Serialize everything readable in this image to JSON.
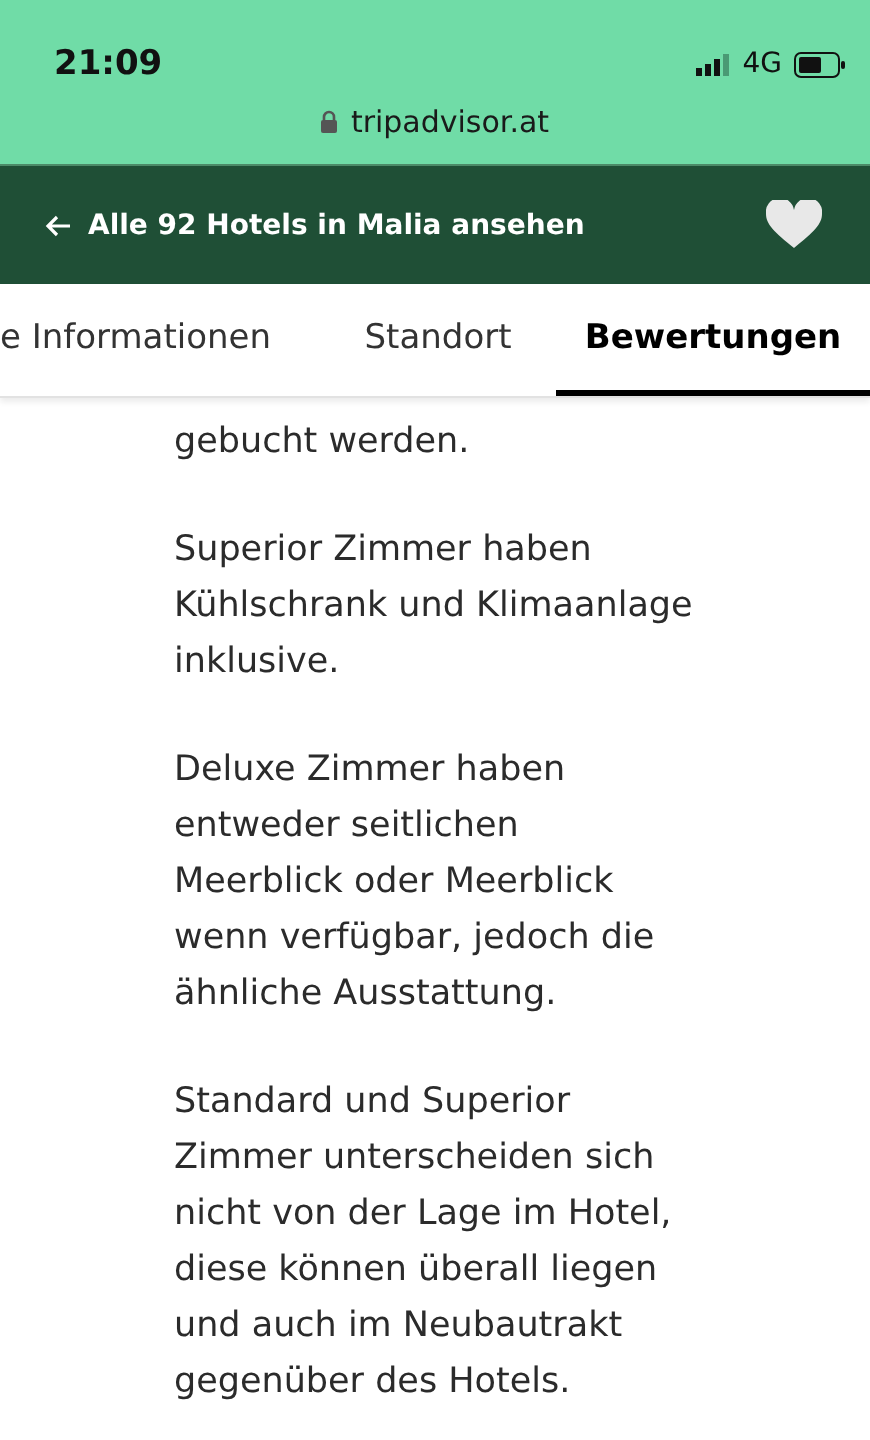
{
  "status_bar": {
    "time": "21:09",
    "network": "4G"
  },
  "address_bar": {
    "url": "tripadvisor.at"
  },
  "header": {
    "back_link": "Alle 92 Hotels in Malia ansehen",
    "favorite": false
  },
  "tabs": [
    {
      "label": "e Informationen",
      "selected": false
    },
    {
      "label": "Standort",
      "selected": false
    },
    {
      "label": "Bewertungen",
      "selected": true
    }
  ],
  "paragraphs": [
    "gebucht werden.",
    "Superior Zimmer haben Kühlschrank und Klimaanlage inklusive.",
    "Deluxe Zimmer haben entweder seitlichen Meerblick oder Meerblick wenn verfügbar, jedoch die ähnliche Ausstattung.",
    "Standard und Superior Zimmer unterscheiden sich nicht von der Lage im Hotel, diese können überall liegen und auch im Neubautrakt gegenüber des Hotels."
  ]
}
